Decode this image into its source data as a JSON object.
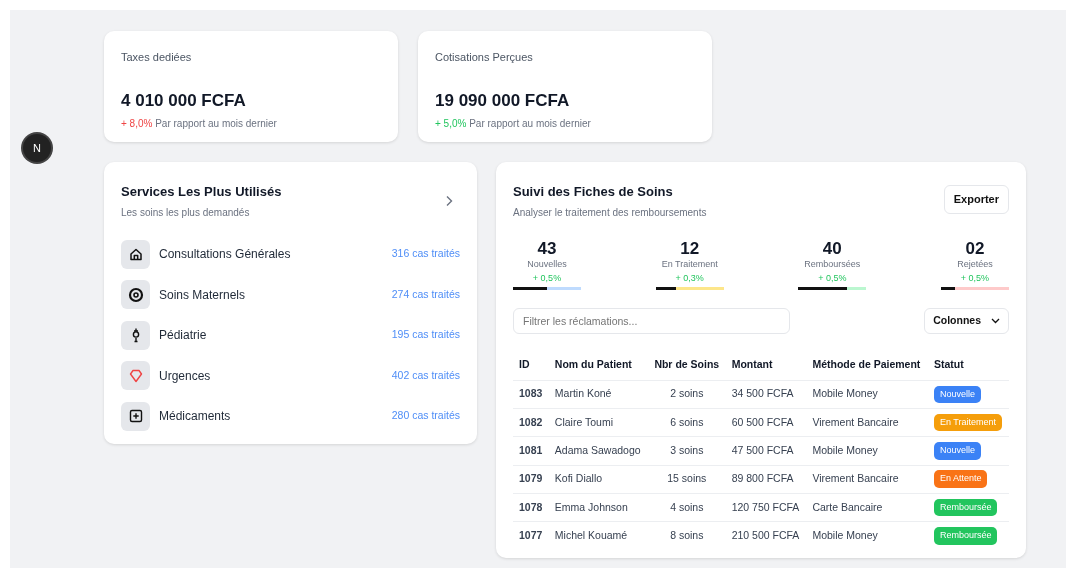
{
  "kpis": [
    {
      "title": "Taxes dediées",
      "value": "4 010 000 FCFA",
      "change": "+ 8,0%",
      "color": "#ef4444",
      "note": "Par rapport au mois dernier"
    },
    {
      "title": "Cotisations Perçues",
      "value": "19 090 000 FCFA",
      "change": "+ 5,0%",
      "color": "#22c55e",
      "note": "Par rapport au mois dernier"
    }
  ],
  "badge": {
    "letter": "N"
  },
  "services": {
    "title": "Services Les Plus Utilisés",
    "subtitle": "Les soins les plus demandés",
    "items": [
      {
        "kind": "home",
        "name": "Consultations Générales",
        "count": "316 cas traités"
      },
      {
        "kind": "target",
        "name": "Soins Maternels",
        "count": "274 cas traités"
      },
      {
        "kind": "figure",
        "name": "Pédiatrie",
        "count": "195 cas traités"
      },
      {
        "kind": "diamond",
        "name": "Urgences",
        "count": "402 cas traités"
      },
      {
        "kind": "plus",
        "name": "Médicaments",
        "count": "280 cas traités"
      }
    ]
  },
  "claims": {
    "title": "Suivi des Fiches de Soins",
    "subtitle": "Analyser le traitement des remboursements",
    "export_button": "Exporter",
    "stats": [
      {
        "value": "43",
        "label": "Nouvelles",
        "change": "+ 0,5%",
        "level": 0.5,
        "color": "#bfdbfe"
      },
      {
        "value": "12",
        "label": "En Traitement",
        "change": "+ 0,3%",
        "level": 0.3,
        "color": "#fde68a"
      },
      {
        "value": "40",
        "label": "Remboursées",
        "change": "+ 0,5%",
        "level": 0.72,
        "color": "#bbf7d0"
      },
      {
        "value": "02",
        "label": "Rejetées",
        "change": "+ 0,5%",
        "level": 0.2,
        "color": "#fecaca"
      }
    ],
    "filter": {
      "placeholder": "Filtrer les réclamations..."
    },
    "columns_button": "Colonnes",
    "table": {
      "columns": [
        "ID",
        "Nom du Patient",
        "Nbr de Soins",
        "Montant",
        "Méthode de Paiement",
        "Statut"
      ],
      "rows": [
        {
          "id": "1083",
          "patient": "Martin Koné",
          "soins": "2 soins",
          "amount": "34 500 FCFA",
          "method": "Mobile Money",
          "status": "Nouvelle",
          "color": "#3b82f6"
        },
        {
          "id": "1082",
          "patient": "Claire Toumi",
          "soins": "6 soins",
          "amount": "60 500 FCFA",
          "method": "Virement Bancaire",
          "status": "En Traitement",
          "color": "#f59e0b"
        },
        {
          "id": "1081",
          "patient": "Adama Sawadogo",
          "soins": "3 soins",
          "amount": "47 500 FCFA",
          "method": "Mobile Money",
          "status": "Nouvelle",
          "color": "#3b82f6"
        },
        {
          "id": "1079",
          "patient": "Kofi Diallo",
          "soins": "15 soins",
          "amount": "89 800 FCFA",
          "method": "Virement Bancaire",
          "status": "En Attente",
          "color": "#f97316"
        },
        {
          "id": "1078",
          "patient": "Emma Johnson",
          "soins": "4 soins",
          "amount": "120 750 FCFA",
          "method": "Carte Bancaire",
          "status": "Remboursée",
          "color": "#22c55e"
        },
        {
          "id": "1077",
          "patient": "Michel Kouamé",
          "soins": "8 soins",
          "amount": "210 500 FCFA",
          "method": "Mobile Money",
          "status": "Remboursée",
          "color": "#22c55e"
        }
      ]
    }
  }
}
